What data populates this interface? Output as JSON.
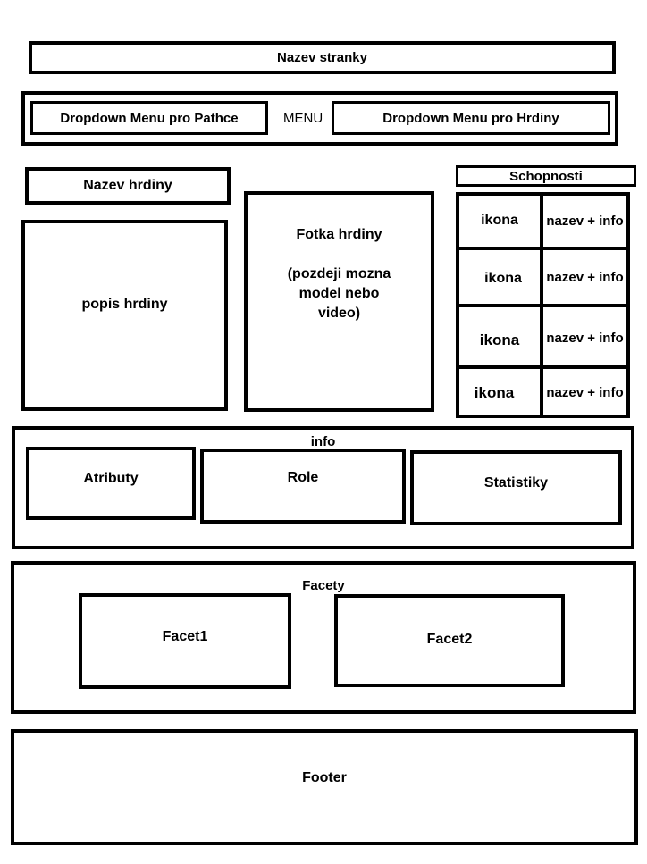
{
  "header": {
    "page_title": "Nazev stranky"
  },
  "nav": {
    "patches_dropdown": "Dropdown Menu pro Pathce",
    "menu_label": "MENU",
    "heroes_dropdown": "Dropdown Menu pro Hrdiny"
  },
  "hero": {
    "name": "Nazev hrdiny",
    "description": "popis hrdiny",
    "photo_line1": "Fotka hrdiny",
    "photo_line2": "(pozdeji mozna",
    "photo_line3": "model nebo",
    "photo_line4": "video)"
  },
  "abilities": {
    "title": "Schopnosti",
    "rows": [
      {
        "icon": "ikona",
        "text": "nazev + info"
      },
      {
        "icon": "ikona",
        "text": "nazev + info"
      },
      {
        "icon": "ikona",
        "text": "nazev + info"
      },
      {
        "icon": "ikona",
        "text": "nazev + info"
      }
    ]
  },
  "info": {
    "title": "info",
    "attributes": "Atributy",
    "role": "Role",
    "stats": "Statistiky"
  },
  "facets": {
    "title": "Facety",
    "facet1": "Facet1",
    "facet2": "Facet2"
  },
  "footer": {
    "label": "Footer"
  }
}
